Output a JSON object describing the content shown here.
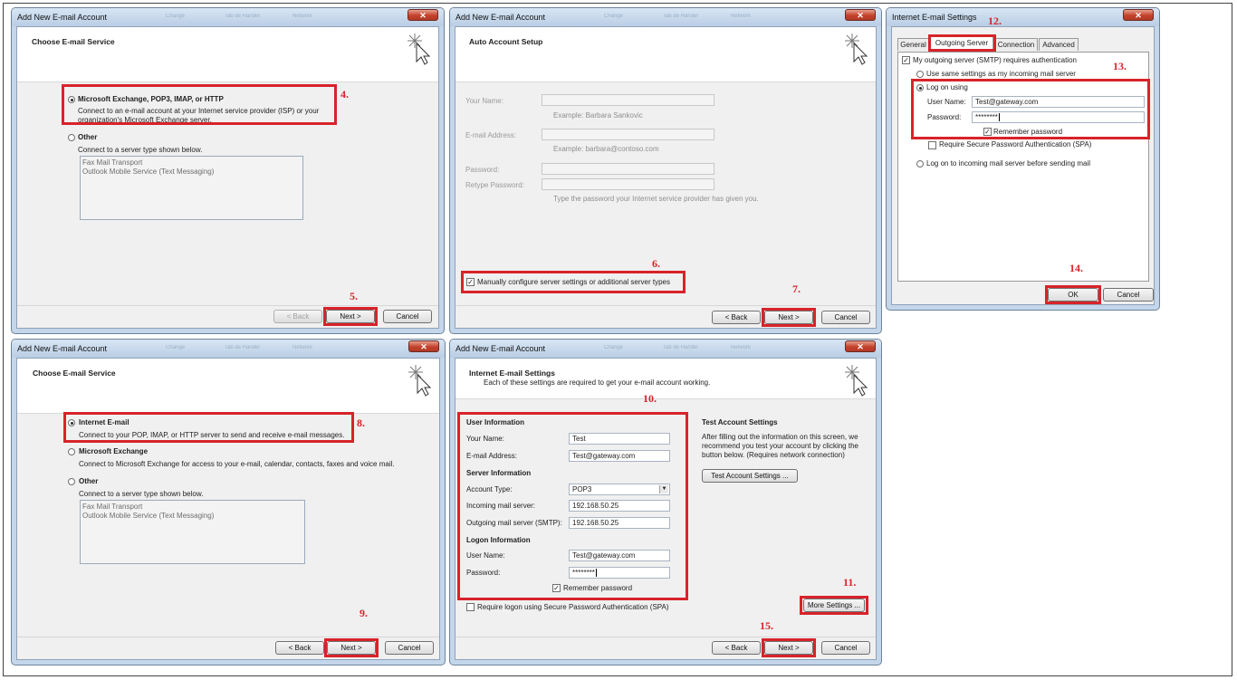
{
  "common": {
    "window_title": "Add New E-mail Account",
    "close_glyph": "✕",
    "ghost_tabs": [
      "Change",
      "Tab de Handel",
      "Network"
    ],
    "back": "< Back",
    "next": "Next >",
    "cancel": "Cancel"
  },
  "w1": {
    "header_title": "Choose E-mail Service",
    "opt_exchange": "Microsoft Exchange, POP3, IMAP, or HTTP",
    "opt_exchange_desc1": "Connect to an e-mail account at your Internet service provider (ISP) or your",
    "opt_exchange_desc2": "organization's Microsoft Exchange server.",
    "opt_other": "Other",
    "opt_other_desc": "Connect to a server type shown below.",
    "list_items": [
      "Fax Mail Transport",
      "Outlook Mobile Service (Text Messaging)"
    ],
    "step_radio": "4.",
    "step_next": "5."
  },
  "w2": {
    "header_title": "Auto Account Setup",
    "your_name_label": "Your Name:",
    "your_name_example": "Example: Barbara Sankovic",
    "email_label": "E-mail Address:",
    "email_example": "Example: barbara@contoso.com",
    "password_label": "Password:",
    "retype_label": "Retype Password:",
    "password_hint": "Type the password your Internet service provider has given you.",
    "manual_config": "Manually configure server settings or additional server types",
    "step_manual": "6.",
    "step_next": "7."
  },
  "w3": {
    "window_title": "Internet E-mail Settings",
    "tabs": [
      "General",
      "Outgoing Server",
      "Connection",
      "Advanced"
    ],
    "smtp_auth": "My outgoing server (SMTP) requires authentication",
    "use_same": "Use same settings as my incoming mail server",
    "log_on_using": "Log on using",
    "user_name_label": "User Name:",
    "user_name_value": "Test@gateway.com",
    "password_label": "Password:",
    "password_value": "********",
    "remember_password": "Remember password",
    "require_spa": "Require Secure Password Authentication (SPA)",
    "log_on_incoming": "Log on to incoming mail server before sending mail",
    "ok": "OK",
    "cancel": "Cancel",
    "step_tab": "12.",
    "step_logon": "13.",
    "step_ok": "14."
  },
  "w4": {
    "header_title": "Choose E-mail Service",
    "opt_internet": "Internet E-mail",
    "opt_internet_desc": "Connect to your POP, IMAP, or HTTP server to send and receive e-mail messages.",
    "opt_exchange": "Microsoft Exchange",
    "opt_exchange_desc": "Connect to Microsoft Exchange for access to your e-mail, calendar, contacts, faxes and voice mail.",
    "opt_other": "Other",
    "opt_other_desc": "Connect to a server type shown below.",
    "list_items": [
      "Fax Mail Transport",
      "Outlook Mobile Service (Text Messaging)"
    ],
    "step_radio": "8.",
    "step_next": "9."
  },
  "w5": {
    "header_title": "Internet E-mail Settings",
    "header_sub": "Each of these settings are required to get your e-mail account working.",
    "user_info": "User Information",
    "your_name_label": "Your Name:",
    "your_name_value": "Test",
    "email_label": "E-mail Address:",
    "email_value": "Test@gateway.com",
    "server_info": "Server Information",
    "account_type_label": "Account Type:",
    "account_type_value": "POP3",
    "incoming_label": "Incoming mail server:",
    "incoming_value": "192.168.50.25",
    "outgoing_label": "Outgoing mail server (SMTP):",
    "outgoing_value": "192.168.50.25",
    "logon_info": "Logon Information",
    "user_name_label": "User Name:",
    "user_name_value": "Test@gateway.com",
    "password_label": "Password:",
    "password_value": "********",
    "remember_password": "Remember password",
    "require_spa": "Require logon using Secure Password Authentication (SPA)",
    "test_title": "Test Account Settings",
    "test_desc1": "After filling out the information on this screen, we",
    "test_desc2": "recommend you test your account by clicking the",
    "test_desc3": "button below. (Requires network connection)",
    "test_button": "Test Account Settings ...",
    "more_settings": "More Settings ...",
    "step_box": "10.",
    "step_more": "11.",
    "step_next": "15."
  }
}
